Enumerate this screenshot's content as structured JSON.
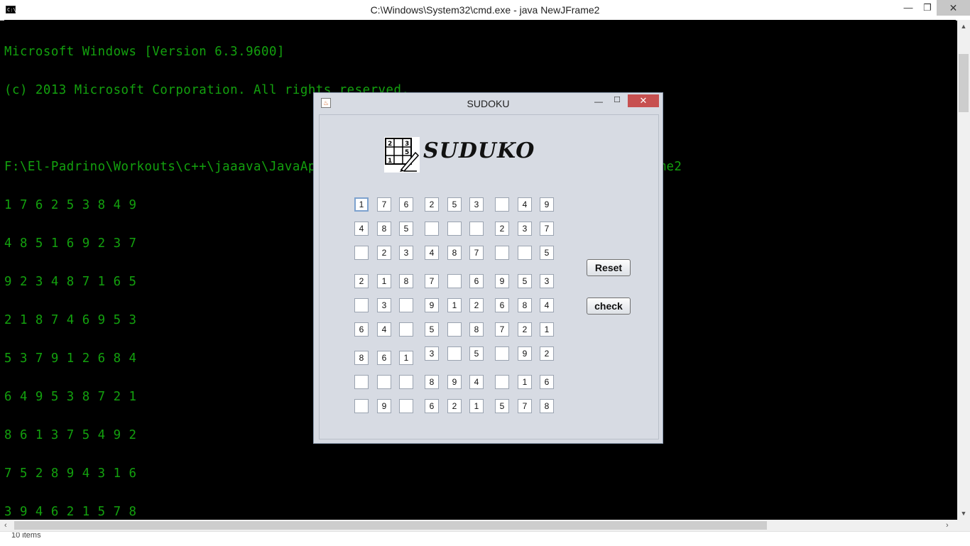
{
  "cmd_window": {
    "title": "C:\\Windows\\System32\\cmd.exe - java  NewJFrame2",
    "icon": "cmd-icon",
    "icon_text": "C:\\",
    "controls": {
      "minimize": "—",
      "maximize": "❐",
      "close": "✕"
    }
  },
  "console": {
    "lines": [
      "Microsoft Windows [Version 6.3.9600]",
      "(c) 2013 Microsoft Corporation. All rights reserved.",
      "",
      "F:\\El-Padrino\\Workouts\\c++\\jaaava\\JavaApplication3\\JavaApplication3\\src>java NewJFrame2",
      "1 7 6 2 5 3 8 4 9",
      "4 8 5 1 6 9 2 3 7",
      "9 2 3 4 8 7 1 6 5",
      "2 1 8 7 4 6 9 5 3",
      "5 3 7 9 1 2 6 8 4",
      "6 4 9 5 3 8 7 2 1",
      "8 6 1 3 7 5 4 9 2",
      "7 5 2 8 9 4 3 1 6",
      "3 9 4 6 2 1 5 7 8"
    ]
  },
  "explorer": {
    "status": "10 items"
  },
  "sudoku_frame": {
    "title": "SUDOKU",
    "controls": {
      "minimize": "—",
      "maximize": "☐",
      "close": "✕"
    },
    "logo_title": "SUDUKO",
    "logo_icon_digits": [
      "2",
      "3",
      "5",
      "1"
    ],
    "grid": [
      [
        "1",
        "7",
        "6",
        "2",
        "5",
        "3",
        "",
        "4",
        "9"
      ],
      [
        "4",
        "8",
        "5",
        "",
        "",
        "",
        "2",
        "3",
        "7"
      ],
      [
        "",
        "2",
        "3",
        "4",
        "8",
        "7",
        "",
        "",
        "5"
      ],
      [
        "2",
        "1",
        "8",
        "7",
        "",
        "6",
        "9",
        "5",
        "3"
      ],
      [
        "",
        "3",
        "",
        "9",
        "1",
        "2",
        "6",
        "8",
        "4"
      ],
      [
        "6",
        "4",
        "",
        "5",
        "",
        "8",
        "7",
        "2",
        "1"
      ],
      [
        "8",
        "6",
        "1",
        "3",
        "",
        "5",
        "",
        "9",
        "2"
      ],
      [
        "",
        "",
        "",
        "8",
        "9",
        "4",
        "",
        "1",
        "6"
      ],
      [
        "",
        "9",
        "",
        "6",
        "2",
        "1",
        "5",
        "7",
        "8"
      ]
    ],
    "buttons": {
      "reset": "Reset",
      "check": "check"
    }
  },
  "colors": {
    "console_text": "#13a10e",
    "console_bg": "#000000",
    "frame_bg": "#d7dbe3",
    "close_red": "#c75050"
  }
}
